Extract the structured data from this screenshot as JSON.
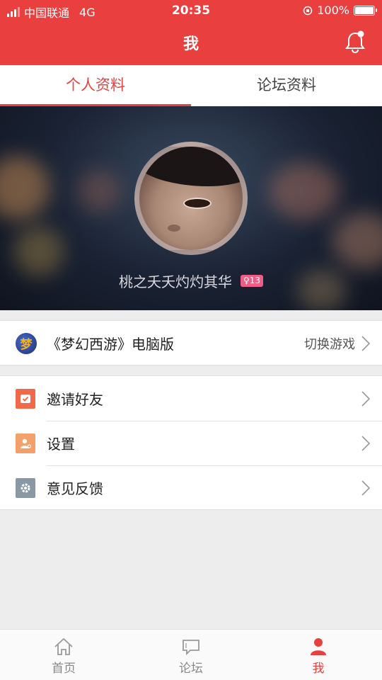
{
  "status": {
    "carrier": "中国联通",
    "network": "4G",
    "time": "20:35",
    "battery": "100%",
    "battery_level": 1.0
  },
  "header": {
    "title": "我",
    "bell_icon": "bell-icon"
  },
  "tabs": [
    {
      "label": "个人资料",
      "active": true
    },
    {
      "label": "论坛资料",
      "active": false
    }
  ],
  "profile": {
    "name": "桃之夭夭灼灼其华",
    "badge": "♀13"
  },
  "game": {
    "title": "《梦幻西游》电脑版",
    "action": "切换游戏",
    "icon_glyph": "梦"
  },
  "menu": [
    {
      "label": "邀请好友",
      "icon": "invite-icon",
      "color": "#f0694a"
    },
    {
      "label": "设置",
      "icon": "settings-user-icon",
      "color": "#f4a06a"
    },
    {
      "label": "意见反馈",
      "icon": "feedback-gear-icon",
      "color": "#8a98a6"
    }
  ],
  "nav": [
    {
      "label": "首页",
      "icon": "home-icon",
      "active": false
    },
    {
      "label": "论坛",
      "icon": "chat-icon",
      "active": false
    },
    {
      "label": "我",
      "icon": "person-icon",
      "active": true
    }
  ],
  "colors": {
    "accent": "#e84040",
    "header": "#ea3f3f"
  }
}
